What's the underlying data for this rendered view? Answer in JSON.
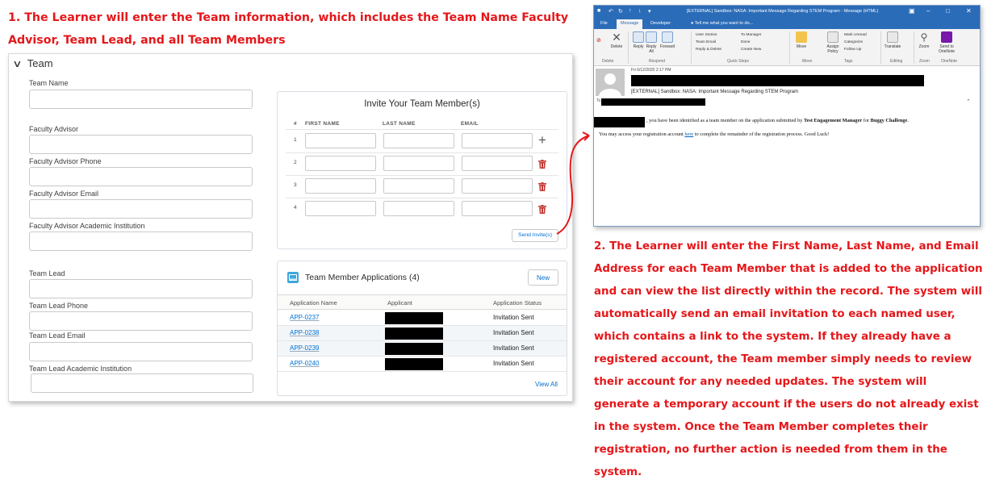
{
  "captions": {
    "step1": "1. The Learner will enter the Team information, which includes the Team Name Faculty Advisor, Team Lead, and all Team Members",
    "step2": "2. The Learner will enter the First Name, Last Name, and Email Address for each Team Member that is added to the application and can view the list directly within the record. The system will automatically send an email invitation to each named user, which contains a link to the system. If they already have a registered account, the Team member simply needs to review their account for any needed updates. The system will generate a temporary account if the users do not already exist in the system. Once the Team Member completes their registration, no further action is needed from them in the system."
  },
  "colors": {
    "caption_red": "#e5171a",
    "link_blue": "#0070d2",
    "delete_red": "#c23934",
    "outlook_blue": "#2b6cb8"
  },
  "team_section": {
    "title": "Team",
    "fields": [
      {
        "label": "Team Name",
        "value": ""
      },
      {
        "label": "Faculty Advisor",
        "value": ""
      },
      {
        "label": "Faculty Advisor Phone",
        "value": ""
      },
      {
        "label": "Faculty Advisor Email",
        "value": ""
      },
      {
        "label": "Faculty Advisor Academic Institution",
        "value": ""
      },
      {
        "label": "Team Lead",
        "value": ""
      },
      {
        "label": "Team Lead Phone",
        "value": ""
      },
      {
        "label": "Team Lead Email",
        "value": ""
      },
      {
        "label": "Team Lead Academic Institution",
        "value": ""
      }
    ]
  },
  "invite": {
    "title": "Invite Your Team Member(s)",
    "columns": [
      "#",
      "FIRST NAME",
      "LAST NAME",
      "EMAIL"
    ],
    "rows": [
      {
        "num": "1",
        "action_icon": "plus-icon"
      },
      {
        "num": "2",
        "action_icon": "trash-icon"
      },
      {
        "num": "3",
        "action_icon": "trash-icon"
      },
      {
        "num": "4",
        "action_icon": "trash-icon"
      }
    ],
    "send_label": "Send Invite(s)"
  },
  "applications": {
    "title": "Team Member Applications (4)",
    "new_label": "New",
    "columns": [
      "Application Name",
      "Applicant",
      "Application Status"
    ],
    "rows": [
      {
        "name": "APP-0237",
        "status": "Invitation Sent"
      },
      {
        "name": "APP-0238",
        "status": "Invitation Sent"
      },
      {
        "name": "APP-0239",
        "status": "Invitation Sent"
      },
      {
        "name": "APP-0240",
        "status": "Invitation Sent"
      }
    ],
    "view_all": "View All"
  },
  "outlook": {
    "title": "[EXTERNAL] Sandbox: NASA: Important Message Regarding STEM Program - Message (HTML)",
    "tabs": [
      "File",
      "Message",
      "Developer"
    ],
    "tell_me": "Tell me what you want to do...",
    "ribbon": {
      "delete": "Delete",
      "reply": "Reply",
      "reply_all": "Reply All",
      "forward": "Forward",
      "user_stories": "User Stories",
      "team_email": "Team Email",
      "reply_delete": "Reply & Delete",
      "to_manager": "To Manager",
      "done": "Done",
      "create_new": "Create New",
      "move": "Move",
      "assign_policy": "Assign Policy",
      "mark_unread": "Mark Unread",
      "categorize": "Categorize",
      "follow_up": "Follow Up",
      "translate": "Translate",
      "zoom": "Zoom",
      "send_onenote": "Send to OneNote",
      "groups": [
        "Delete",
        "Respond",
        "Quick Steps",
        "Move",
        "Tags",
        "Editing",
        "Zoom",
        "OneNote"
      ]
    },
    "date": "Fri 6/12/2020 2:17 PM",
    "subject": "[EXTERNAL] Sandbox: NASA: Important Message Regarding STEM Program",
    "body_line1_pre": ", you have been identified as a team member on the application submitted by ",
    "body_manager": "Test Engagement Manager",
    "body_for": " for ",
    "body_challenge": "Buggy Challenge",
    "body_line2_pre": "You may access your registration account ",
    "body_link": "here",
    "body_line2_post": " to complete the remainder of the registration process. Good Luck!"
  }
}
